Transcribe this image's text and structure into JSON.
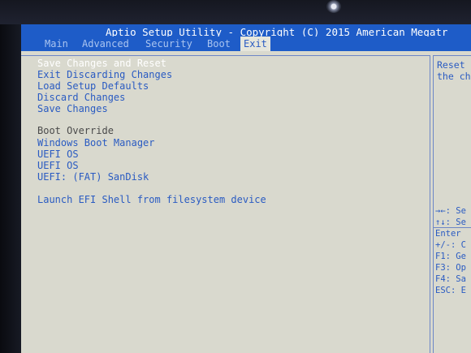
{
  "title": "Aptio Setup Utility - Copyright (C) 2015 American Megatr",
  "tabs": [
    {
      "label": "Main"
    },
    {
      "label": "Advanced"
    },
    {
      "label": "Security"
    },
    {
      "label": "Boot"
    },
    {
      "label": "Exit"
    }
  ],
  "menu": {
    "items": [
      {
        "label": "Save Changes and Reset"
      },
      {
        "label": "Exit Discarding Changes"
      },
      {
        "label": "Load Setup Defaults"
      },
      {
        "label": "Discard Changes"
      },
      {
        "label": "Save Changes"
      }
    ],
    "boot_override_heading": "Boot Override",
    "boot_items": [
      {
        "label": "Windows Boot Manager"
      },
      {
        "label": "UEFI OS"
      },
      {
        "label": "UEFI OS"
      },
      {
        "label": "UEFI: (FAT) SanDisk"
      }
    ],
    "efi_shell": "Launch EFI Shell from filesystem device"
  },
  "help": {
    "line1": "Reset",
    "line2": "the ch"
  },
  "keys": [
    "→←: Se",
    "↑↓: Se",
    "Enter",
    "+/-: C",
    "F1: Ge",
    "F3: Op",
    "F4: Sa",
    "ESC: E"
  ]
}
